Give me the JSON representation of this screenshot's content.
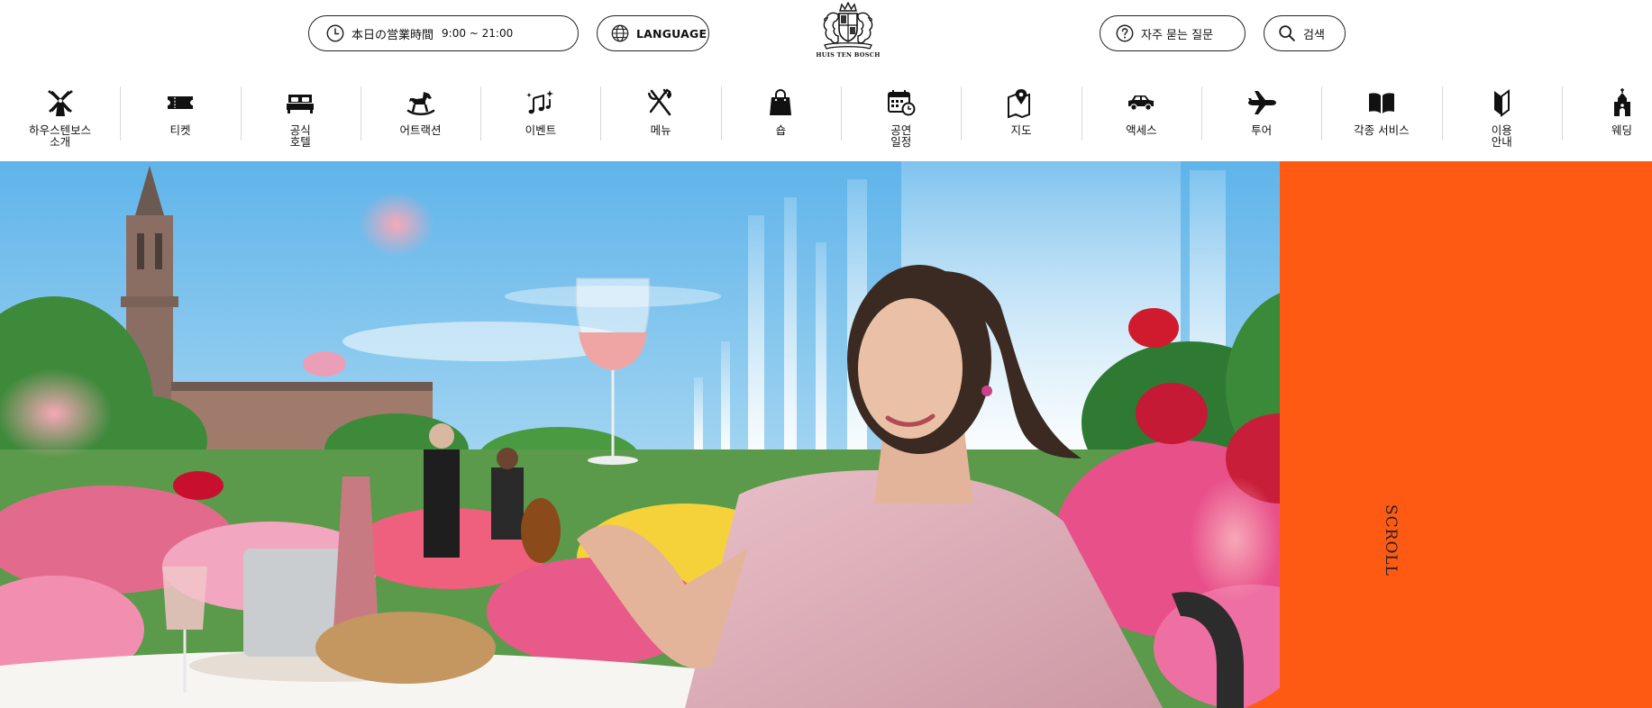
{
  "header": {
    "hours_label": "本日の営業時間",
    "hours_time": "9:00 ~ 21:00",
    "language_label": "LANGUAGE",
    "logo_text": "HUIS TEN BOSCH",
    "faq_label": "자주 묻는 질문",
    "search_label": "검색"
  },
  "nav": {
    "items": [
      {
        "label": "하우스텐보스\n소개",
        "icon": "windmill-icon"
      },
      {
        "label": "티켓",
        "icon": "ticket-icon"
      },
      {
        "label": "공식\n호텔",
        "icon": "bed-icon"
      },
      {
        "label": "어트랙션",
        "icon": "rocking-horse-icon"
      },
      {
        "label": "이벤트",
        "icon": "music-notes-icon"
      },
      {
        "label": "메뉴",
        "icon": "fork-knife-icon"
      },
      {
        "label": "숍",
        "icon": "shopping-bag-icon"
      },
      {
        "label": "공연\n일정",
        "icon": "calendar-clock-icon"
      },
      {
        "label": "지도",
        "icon": "map-pin-icon"
      },
      {
        "label": "액세스",
        "icon": "car-icon"
      },
      {
        "label": "투어",
        "icon": "airplane-icon"
      },
      {
        "label": "각종 서비스",
        "icon": "book-icon"
      },
      {
        "label": "이용\n안내",
        "icon": "beginner-mark-icon"
      },
      {
        "label": "웨딩",
        "icon": "chapel-icon"
      }
    ]
  },
  "hero": {
    "image": "rose-garden-woman-wine-toast",
    "scroll_label": "SCROLL"
  },
  "colors": {
    "accent": "#ff5a14",
    "text": "#111111",
    "sky": "#7ec3ea"
  }
}
